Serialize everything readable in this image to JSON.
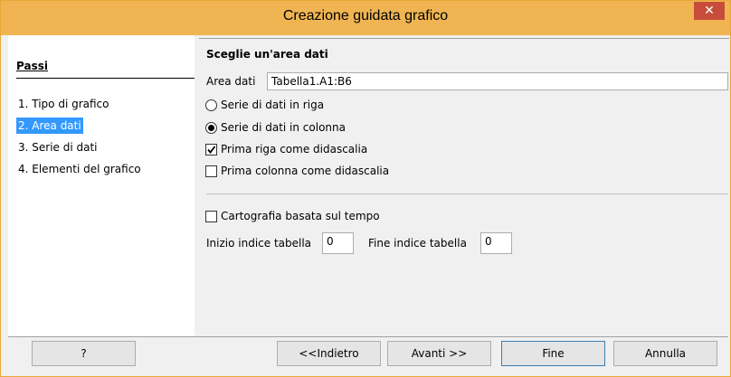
{
  "window": {
    "title": "Creazione guidata grafico",
    "close_symbol": "✕"
  },
  "steps": {
    "heading": "Passi",
    "items": [
      "1. Tipo di grafico",
      "2. Area dati",
      "3. Serie di dati",
      "4. Elementi del grafico"
    ],
    "active_index": 1
  },
  "main": {
    "heading": "Sceglie un'area dati",
    "range_label": "Area dati",
    "range_value": "Tabella1.A1:B6",
    "radio_rows": "Serie di dati in riga",
    "radio_columns": "Serie di dati in colonna",
    "radio_selected": "columns",
    "first_row_label": "Prima riga come didascalia",
    "first_row_checked": true,
    "first_column_label": "Prima colonna come didascalia",
    "first_column_checked": false,
    "time_mapping_label": "Cartografia basata sul tempo",
    "time_mapping_checked": false,
    "start_index_label": "Inizio indice tabella",
    "start_index_value": "0",
    "end_index_label": "Fine indice tabella",
    "end_index_value": "0"
  },
  "buttons": {
    "help": "?",
    "back": "<<Indietro",
    "next": "Avanti >>",
    "finish": "Fine",
    "cancel": "Annulla"
  },
  "colors": {
    "titlebar": "#f0b552",
    "close": "#c74d3a",
    "selection": "#3399ff"
  }
}
